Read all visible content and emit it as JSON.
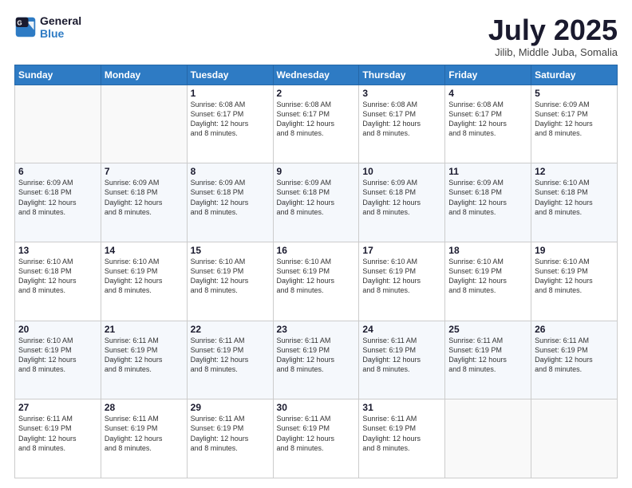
{
  "logo": {
    "line1": "General",
    "line2": "Blue"
  },
  "title": "July 2025",
  "subtitle": "Jilib, Middle Juba, Somalia",
  "days_header": [
    "Sunday",
    "Monday",
    "Tuesday",
    "Wednesday",
    "Thursday",
    "Friday",
    "Saturday"
  ],
  "weeks": [
    [
      {
        "num": "",
        "info": ""
      },
      {
        "num": "",
        "info": ""
      },
      {
        "num": "1",
        "info": "Sunrise: 6:08 AM\nSunset: 6:17 PM\nDaylight: 12 hours\nand 8 minutes."
      },
      {
        "num": "2",
        "info": "Sunrise: 6:08 AM\nSunset: 6:17 PM\nDaylight: 12 hours\nand 8 minutes."
      },
      {
        "num": "3",
        "info": "Sunrise: 6:08 AM\nSunset: 6:17 PM\nDaylight: 12 hours\nand 8 minutes."
      },
      {
        "num": "4",
        "info": "Sunrise: 6:08 AM\nSunset: 6:17 PM\nDaylight: 12 hours\nand 8 minutes."
      },
      {
        "num": "5",
        "info": "Sunrise: 6:09 AM\nSunset: 6:17 PM\nDaylight: 12 hours\nand 8 minutes."
      }
    ],
    [
      {
        "num": "6",
        "info": "Sunrise: 6:09 AM\nSunset: 6:18 PM\nDaylight: 12 hours\nand 8 minutes."
      },
      {
        "num": "7",
        "info": "Sunrise: 6:09 AM\nSunset: 6:18 PM\nDaylight: 12 hours\nand 8 minutes."
      },
      {
        "num": "8",
        "info": "Sunrise: 6:09 AM\nSunset: 6:18 PM\nDaylight: 12 hours\nand 8 minutes."
      },
      {
        "num": "9",
        "info": "Sunrise: 6:09 AM\nSunset: 6:18 PM\nDaylight: 12 hours\nand 8 minutes."
      },
      {
        "num": "10",
        "info": "Sunrise: 6:09 AM\nSunset: 6:18 PM\nDaylight: 12 hours\nand 8 minutes."
      },
      {
        "num": "11",
        "info": "Sunrise: 6:09 AM\nSunset: 6:18 PM\nDaylight: 12 hours\nand 8 minutes."
      },
      {
        "num": "12",
        "info": "Sunrise: 6:10 AM\nSunset: 6:18 PM\nDaylight: 12 hours\nand 8 minutes."
      }
    ],
    [
      {
        "num": "13",
        "info": "Sunrise: 6:10 AM\nSunset: 6:18 PM\nDaylight: 12 hours\nand 8 minutes."
      },
      {
        "num": "14",
        "info": "Sunrise: 6:10 AM\nSunset: 6:19 PM\nDaylight: 12 hours\nand 8 minutes."
      },
      {
        "num": "15",
        "info": "Sunrise: 6:10 AM\nSunset: 6:19 PM\nDaylight: 12 hours\nand 8 minutes."
      },
      {
        "num": "16",
        "info": "Sunrise: 6:10 AM\nSunset: 6:19 PM\nDaylight: 12 hours\nand 8 minutes."
      },
      {
        "num": "17",
        "info": "Sunrise: 6:10 AM\nSunset: 6:19 PM\nDaylight: 12 hours\nand 8 minutes."
      },
      {
        "num": "18",
        "info": "Sunrise: 6:10 AM\nSunset: 6:19 PM\nDaylight: 12 hours\nand 8 minutes."
      },
      {
        "num": "19",
        "info": "Sunrise: 6:10 AM\nSunset: 6:19 PM\nDaylight: 12 hours\nand 8 minutes."
      }
    ],
    [
      {
        "num": "20",
        "info": "Sunrise: 6:10 AM\nSunset: 6:19 PM\nDaylight: 12 hours\nand 8 minutes."
      },
      {
        "num": "21",
        "info": "Sunrise: 6:11 AM\nSunset: 6:19 PM\nDaylight: 12 hours\nand 8 minutes."
      },
      {
        "num": "22",
        "info": "Sunrise: 6:11 AM\nSunset: 6:19 PM\nDaylight: 12 hours\nand 8 minutes."
      },
      {
        "num": "23",
        "info": "Sunrise: 6:11 AM\nSunset: 6:19 PM\nDaylight: 12 hours\nand 8 minutes."
      },
      {
        "num": "24",
        "info": "Sunrise: 6:11 AM\nSunset: 6:19 PM\nDaylight: 12 hours\nand 8 minutes."
      },
      {
        "num": "25",
        "info": "Sunrise: 6:11 AM\nSunset: 6:19 PM\nDaylight: 12 hours\nand 8 minutes."
      },
      {
        "num": "26",
        "info": "Sunrise: 6:11 AM\nSunset: 6:19 PM\nDaylight: 12 hours\nand 8 minutes."
      }
    ],
    [
      {
        "num": "27",
        "info": "Sunrise: 6:11 AM\nSunset: 6:19 PM\nDaylight: 12 hours\nand 8 minutes."
      },
      {
        "num": "28",
        "info": "Sunrise: 6:11 AM\nSunset: 6:19 PM\nDaylight: 12 hours\nand 8 minutes."
      },
      {
        "num": "29",
        "info": "Sunrise: 6:11 AM\nSunset: 6:19 PM\nDaylight: 12 hours\nand 8 minutes."
      },
      {
        "num": "30",
        "info": "Sunrise: 6:11 AM\nSunset: 6:19 PM\nDaylight: 12 hours\nand 8 minutes."
      },
      {
        "num": "31",
        "info": "Sunrise: 6:11 AM\nSunset: 6:19 PM\nDaylight: 12 hours\nand 8 minutes."
      },
      {
        "num": "",
        "info": ""
      },
      {
        "num": "",
        "info": ""
      }
    ]
  ]
}
